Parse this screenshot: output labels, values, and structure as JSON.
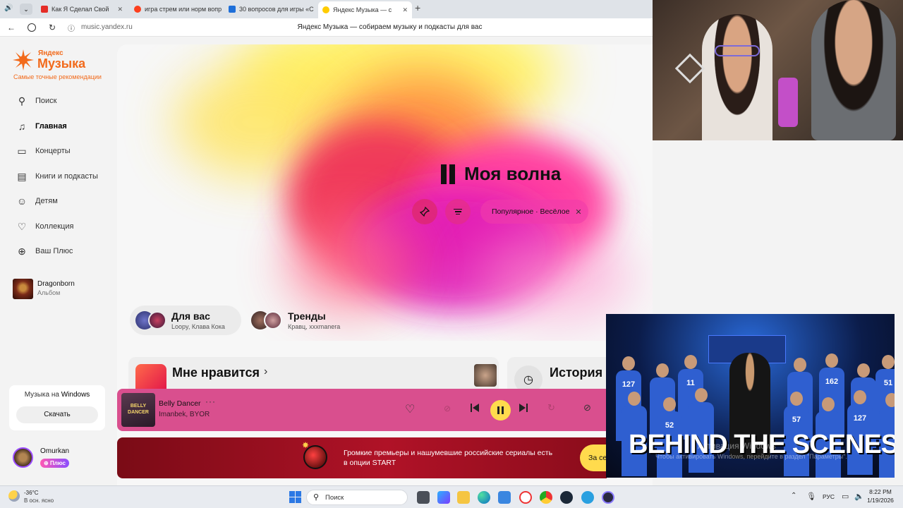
{
  "browser": {
    "tabs": [
      {
        "title": "Как Я Сделал Свой",
        "color": "#e52d27"
      },
      {
        "title": "игра стрем или норм вопр",
        "color": "#fc3f1d"
      },
      {
        "title": "30 вопросов для игры «С",
        "color": "#1e6fd9"
      },
      {
        "title": "Яндекс Музыка — с",
        "color": "#ffcc00"
      }
    ],
    "url": "music.yandex.ru",
    "page_title": "Яндекс Музыка — собираем музыку и подкасты для вас"
  },
  "sidebar": {
    "logo_small": "Яндекс",
    "logo_big": "Музыка",
    "tagline": "Самые точные рекомендации",
    "items": [
      {
        "label": "Поиск",
        "icon": "search-icon",
        "glyph": "⚲"
      },
      {
        "label": "Главная",
        "icon": "home-icon",
        "glyph": "♫"
      },
      {
        "label": "Концерты",
        "icon": "ticket-icon",
        "glyph": "▭"
      },
      {
        "label": "Книги и подкасты",
        "icon": "book-icon",
        "glyph": "▤"
      },
      {
        "label": "Детям",
        "icon": "kids-icon",
        "glyph": "☺"
      },
      {
        "label": "Коллекция",
        "icon": "heart-icon",
        "glyph": "♡"
      },
      {
        "label": "Ваш Плюс",
        "icon": "plus-icon",
        "glyph": "⊕"
      }
    ],
    "recent": {
      "title": "Dragonborn",
      "subtitle": "Альбом"
    },
    "promo": {
      "text_pre": "Музыка на ",
      "text_bold": "Windows",
      "button": "Скачать"
    },
    "user": {
      "name": "Omurkan",
      "badge": "Плюс"
    }
  },
  "main": {
    "wave_title": "Моя волна",
    "wave_filter": "Популярное · Весёлое",
    "cards": [
      {
        "title": "Для вас",
        "subtitle": "Loopy, Клава Кока"
      },
      {
        "title": "Тренды",
        "subtitle": "Кравц, xxxmanera"
      }
    ],
    "likes_title": "Мне нравится",
    "history_title": "История"
  },
  "player": {
    "cover_text": "BELLY DANCER",
    "track": "Belly Dancer",
    "artist": "Imanbek, BYOR"
  },
  "banner": {
    "line1": "Громкие премьеры и нашумевшие российские сериалы есть",
    "line2": "в опции START",
    "button": "За се"
  },
  "video": {
    "caption": "BEHIND THE SCENES",
    "watermark1": "Активация Windows",
    "watermark2": "Чтобы активировать Windows, перейдите в раздел \"Параметры\".",
    "jerseys": [
      "127",
      "11",
      "162",
      "51",
      "52",
      "57"
    ]
  },
  "taskbar": {
    "weather_temp": "-36°C",
    "weather_desc": "В осн. ясно",
    "search": "Поиск",
    "lang": "РУС",
    "time": "8:22 PM",
    "date": "1/19/2026"
  },
  "colors": {
    "accent_yellow": "#ffdb4d",
    "player_pink": "#d94f8e",
    "plus_purple": "#9b4dff"
  }
}
